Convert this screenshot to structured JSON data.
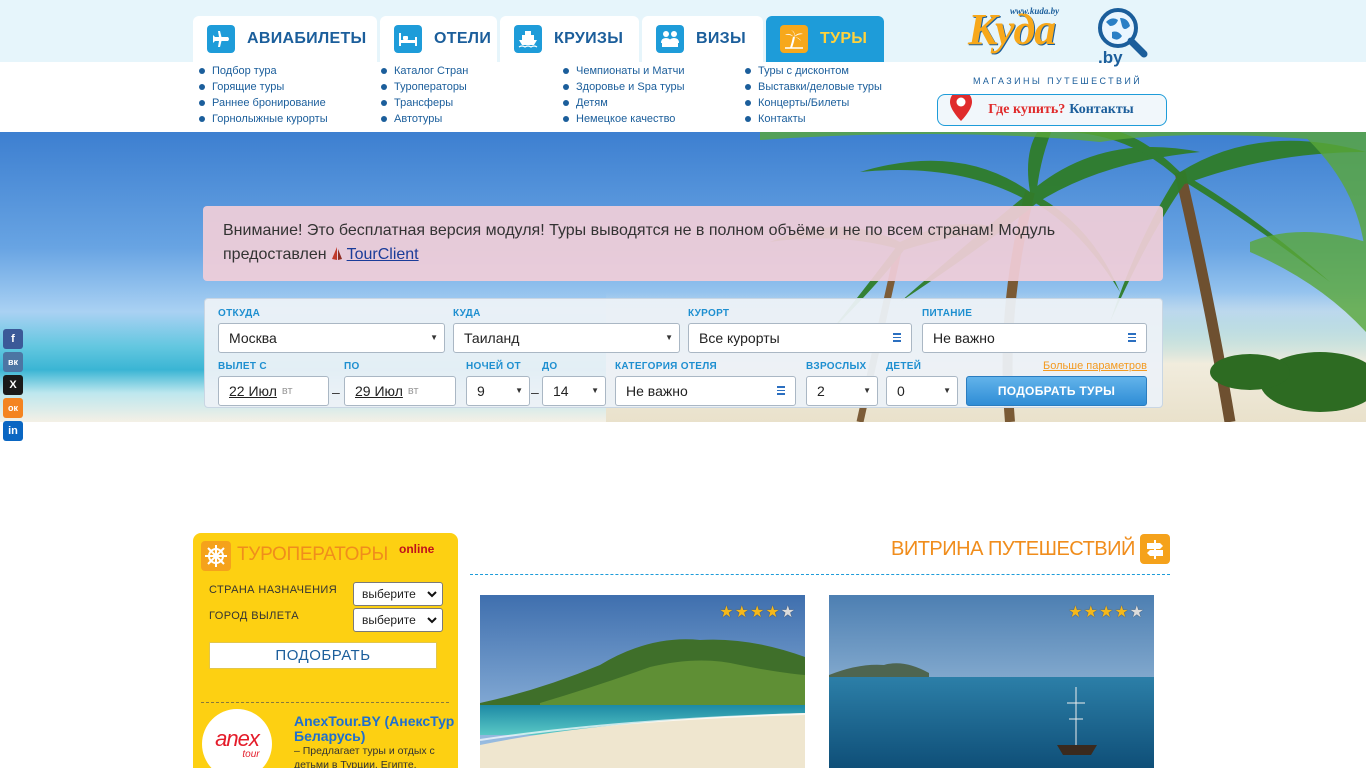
{
  "nav": {
    "tabs": [
      {
        "label": "АВИАБИЛЕТЫ",
        "icon": "airplane-icon"
      },
      {
        "label": "ОТЕЛИ",
        "icon": "bed-icon"
      },
      {
        "label": "КРУИЗЫ",
        "icon": "ship-icon"
      },
      {
        "label": "ВИЗЫ",
        "icon": "visa-icon"
      },
      {
        "label": "ТУРЫ",
        "icon": "palm-icon",
        "active": true
      }
    ]
  },
  "menus": [
    [
      "Подбор тура",
      "Горящие туры",
      "Раннее бронирование",
      "Горнолыжные курорты"
    ],
    [
      "Каталог Стран",
      "Туроператоры",
      "Трансферы",
      "Автотуры"
    ],
    [
      "Чемпионаты и Матчи",
      "Здоровье и Spa туры",
      "Детям",
      "Немецкое качество"
    ],
    [
      "Туры с дисконтом",
      "Выставки/деловые туры",
      "Концерты/Билеты",
      "Контакты"
    ]
  ],
  "logo": {
    "url": "www.kuda.by",
    "word": "Куда",
    "suffix": ".by",
    "tagline": "МАГАЗИНЫ ПУТЕШЕСТВИЙ"
  },
  "where_button": {
    "part1": "Где купить?",
    "part2": "Контакты"
  },
  "notice": {
    "text": "Внимание! Это бесплатная версия модуля! Туры выводятся не в полном объёме и не по всем странам! Модуль предоставлен",
    "link": "TourClient"
  },
  "search": {
    "from_label": "ОТКУДА",
    "from_value": "Москва",
    "to_label": "КУДА",
    "to_value": "Таиланд",
    "resort_label": "КУРОРТ",
    "resort_value": "Все курорты",
    "meal_label": "ПИТАНИЕ",
    "meal_value": "Не важно",
    "depart_label": "ВЫЛЕТ С",
    "depart_date": "22 Июл",
    "depart_dow": "вт",
    "until_label": "ПО",
    "until_date": "29 Июл",
    "until_dow": "вт",
    "nights_from_label": "НОЧЕЙ ОТ",
    "nights_from": "9",
    "nights_to_label": "ДО",
    "nights_to": "14",
    "hotel_cat_label": "КАТЕГОРИЯ ОТЕЛЯ",
    "hotel_cat_value": "Не важно",
    "adults_label": "ВЗРОСЛЫХ",
    "adults": "2",
    "children_label": "ДЕТЕЙ",
    "children": "0",
    "more_params": "Больше параметров",
    "submit": "ПОДОБРАТЬ ТУРЫ"
  },
  "social": [
    {
      "name": "facebook",
      "glyph": "f",
      "color": "#3b5998"
    },
    {
      "name": "vk",
      "glyph": "вк",
      "color": "#4c75a3"
    },
    {
      "name": "x",
      "glyph": "X",
      "color": "#1a1a1a"
    },
    {
      "name": "odnoklassniki",
      "glyph": "ок",
      "color": "#f48420"
    },
    {
      "name": "linkedin",
      "glyph": "in",
      "color": "#0a66c2"
    }
  ],
  "operators": {
    "title": "ТУРОПЕРАТОРЫ",
    "online": "online",
    "country_label": "СТРАНА НАЗНАЧЕНИЯ",
    "country_value": "выберите",
    "city_label": "ГОРОД ВЫЛЕТА",
    "city_value": "выберите",
    "button": "ПОДОБРАТЬ",
    "anex": {
      "logo_text": "anex",
      "logo_sub": "tour",
      "title": "AnexTour.BY (АнексТур Беларусь)",
      "desc": "– Предлагает туры и отдых с детьми в Турции, Египте,"
    }
  },
  "showcase": {
    "title": "ВИТРИНА ПУТЕШЕСТВИЙ",
    "cards": [
      {
        "stars": 4,
        "max": 5
      },
      {
        "stars": 4,
        "max": 5
      }
    ]
  },
  "colors": {
    "brand_blue": "#1e9cd9",
    "accent_orange": "#f7a81b",
    "operators_yellow": "#fdd012"
  }
}
